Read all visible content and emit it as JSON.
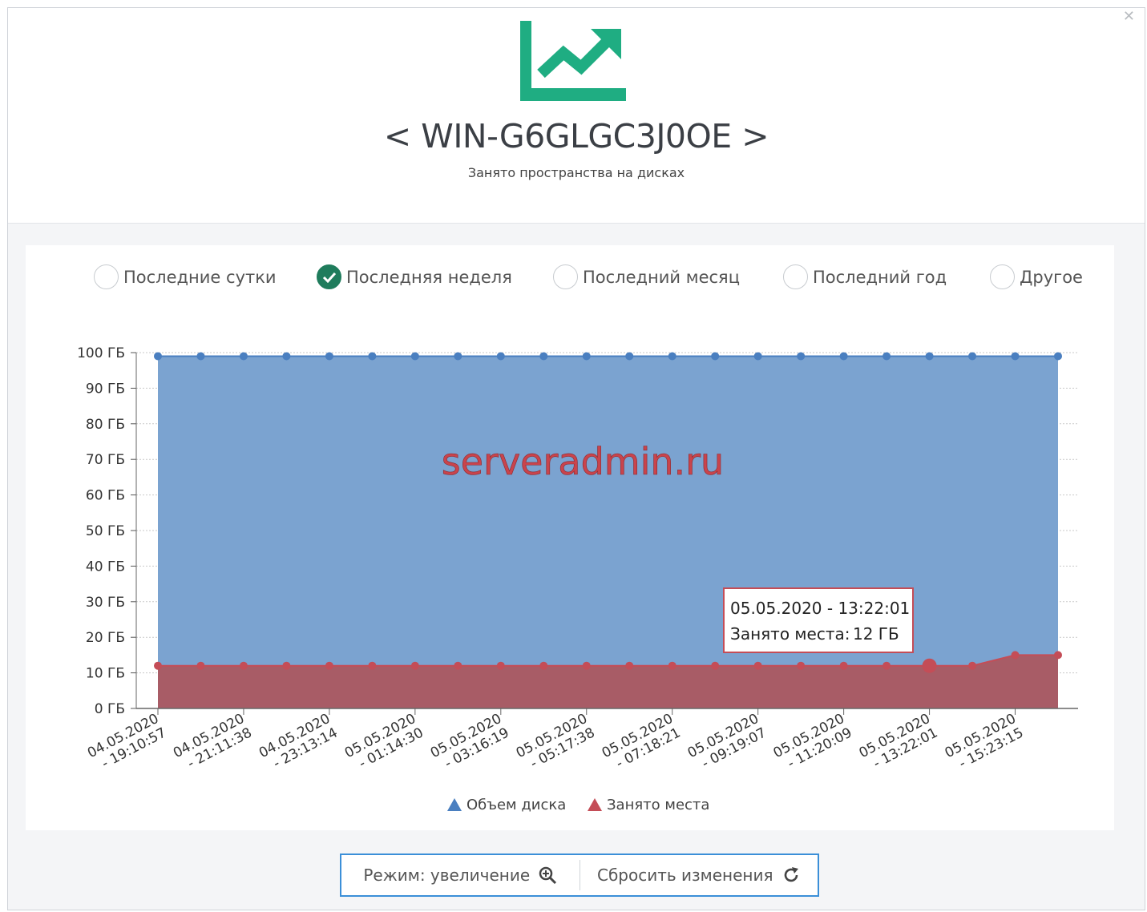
{
  "header": {
    "host_title": "< WIN-G6GLGC3J0OE >",
    "subtitle": "Занято пространства на дисках",
    "logo_icon": "trending-up-chart-icon",
    "accent": "#1fad82"
  },
  "range_options": [
    {
      "label": "Последние сутки",
      "checked": false
    },
    {
      "label": "Последняя неделя",
      "checked": true
    },
    {
      "label": "Последний месяц",
      "checked": false
    },
    {
      "label": "Последний год",
      "checked": false
    },
    {
      "label": "Другое",
      "checked": false
    }
  ],
  "watermark": "serveradmin.ru",
  "tooltip": {
    "time": "05.05.2020 - 13:22:01",
    "label": "Занято места:",
    "value": "12 ГБ"
  },
  "buttons": {
    "zoom_label": "Режим: увеличение",
    "reset_label": "Сбросить изменения"
  },
  "chart_data": {
    "type": "area",
    "unit": "ГБ",
    "ylim": [
      0,
      100
    ],
    "yticks": [
      0,
      10,
      20,
      30,
      40,
      50,
      60,
      70,
      80,
      90,
      100
    ],
    "ytick_labels": [
      "0 ГБ",
      "10 ГБ",
      "20 ГБ",
      "30 ГБ",
      "40 ГБ",
      "50 ГБ",
      "60 ГБ",
      "70 ГБ",
      "80 ГБ",
      "90 ГБ",
      "100 ГБ"
    ],
    "xtick_labels": [
      [
        "04.05.2020",
        "- 19:10:57"
      ],
      [
        "04.05.2020",
        "- 21:11:38"
      ],
      [
        "04.05.2020",
        "- 23:13:14"
      ],
      [
        "05.05.2020",
        "- 01:14:30"
      ],
      [
        "05.05.2020",
        "- 03:16:19"
      ],
      [
        "05.05.2020",
        "- 05:17:38"
      ],
      [
        "05.05.2020",
        "- 07:18:21"
      ],
      [
        "05.05.2020",
        "- 09:19:07"
      ],
      [
        "05.05.2020",
        "- 11:20:09"
      ],
      [
        "05.05.2020",
        "- 13:22:01"
      ],
      [
        "05.05.2020",
        "- 15:23:15"
      ]
    ],
    "grid": true,
    "legend_position": "bottom",
    "series": [
      {
        "name": "Объем диска",
        "color": "#7ba3d0",
        "line_color": "#4a7fc0",
        "values": [
          99,
          99,
          99,
          99,
          99,
          99,
          99,
          99,
          99,
          99,
          99,
          99,
          99,
          99,
          99,
          99,
          99,
          99,
          99,
          99,
          99,
          99
        ]
      },
      {
        "name": "Занято места",
        "color": "#a85c66",
        "line_color": "#c44d57",
        "values": [
          12,
          12,
          12,
          12,
          12,
          12,
          12,
          12,
          12,
          12,
          12,
          12,
          12,
          12,
          12,
          12,
          12,
          12,
          12,
          12,
          15,
          15
        ]
      }
    ],
    "highlight_index": 18
  }
}
